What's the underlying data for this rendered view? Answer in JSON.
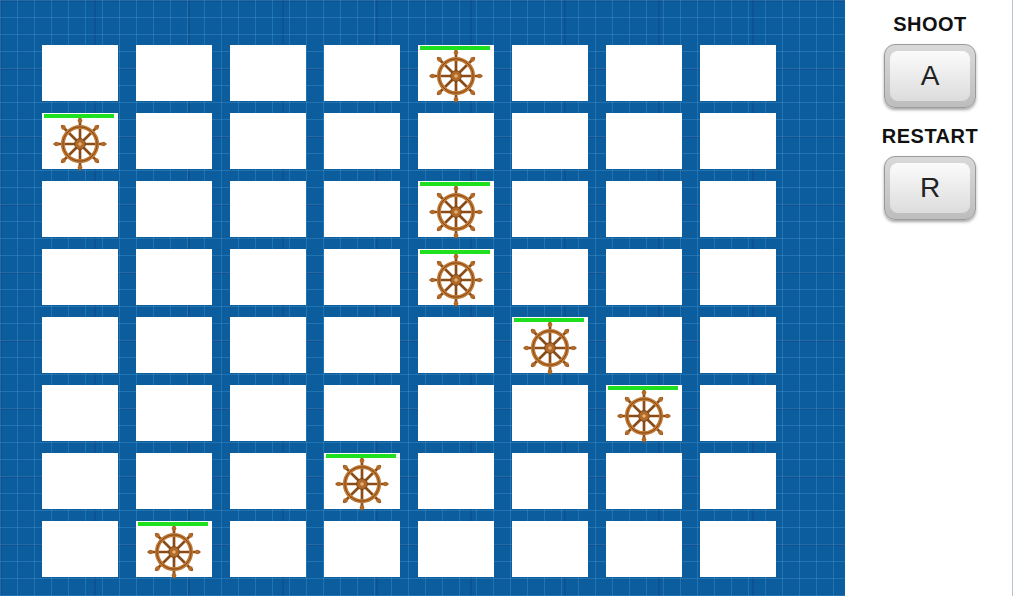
{
  "board": {
    "rows": [
      [
        {
          "ship": false
        },
        {
          "ship": false
        },
        {
          "ship": false
        },
        {
          "ship": false
        },
        {
          "ship": true,
          "level": 1
        },
        {
          "ship": false
        },
        {
          "ship": false
        },
        {
          "ship": false
        }
      ],
      [
        {
          "ship": true,
          "level": 1
        },
        {
          "ship": false
        },
        {
          "ship": false
        },
        {
          "ship": false
        },
        {
          "ship": false
        },
        {
          "ship": false
        },
        {
          "ship": false
        },
        {
          "ship": false
        }
      ],
      [
        {
          "ship": false
        },
        {
          "ship": false
        },
        {
          "ship": false
        },
        {
          "ship": false
        },
        {
          "ship": true,
          "level": 1
        },
        {
          "ship": false
        },
        {
          "ship": false
        },
        {
          "ship": false
        }
      ],
      [
        {
          "ship": false
        },
        {
          "ship": false
        },
        {
          "ship": false
        },
        {
          "ship": false
        },
        {
          "ship": true,
          "level": 1
        },
        {
          "ship": false
        },
        {
          "ship": false
        },
        {
          "ship": false
        }
      ],
      [
        {
          "ship": false
        },
        {
          "ship": false
        },
        {
          "ship": false
        },
        {
          "ship": false
        },
        {
          "ship": false
        },
        {
          "ship": true,
          "level": 1
        },
        {
          "ship": false
        },
        {
          "ship": false
        }
      ],
      [
        {
          "ship": false
        },
        {
          "ship": false
        },
        {
          "ship": false
        },
        {
          "ship": false
        },
        {
          "ship": false
        },
        {
          "ship": false
        },
        {
          "ship": true,
          "level": 1
        },
        {
          "ship": false
        }
      ],
      [
        {
          "ship": false
        },
        {
          "ship": false
        },
        {
          "ship": false
        },
        {
          "ship": true,
          "level": 1
        },
        {
          "ship": false
        },
        {
          "ship": false
        },
        {
          "ship": false
        },
        {
          "ship": false
        }
      ],
      [
        {
          "ship": false
        },
        {
          "ship": true,
          "level": 1
        },
        {
          "ship": false
        },
        {
          "ship": false
        },
        {
          "ship": false
        },
        {
          "ship": false
        },
        {
          "ship": false
        },
        {
          "ship": false
        }
      ]
    ]
  },
  "controls": [
    {
      "label": "SHOOT",
      "key": "A"
    },
    {
      "label": "RESTART",
      "key": "R"
    }
  ]
}
